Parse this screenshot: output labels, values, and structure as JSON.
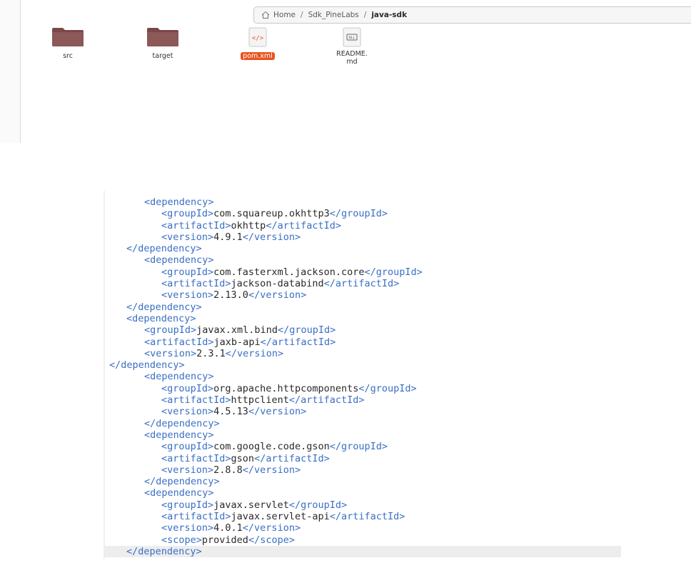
{
  "breadcrumb": {
    "items": [
      "Home",
      "Sdk_PineLabs",
      "java-sdk"
    ],
    "separator": "/"
  },
  "files": [
    {
      "name": "src",
      "type": "folder",
      "icon": "folder-icon"
    },
    {
      "name": "target",
      "type": "folder",
      "icon": "folder-icon"
    },
    {
      "name": "pom.xml",
      "type": "xml",
      "icon": "xml-file-icon",
      "selected": true
    },
    {
      "name": "README.\nmd",
      "type": "markdown",
      "icon": "markdown-file-icon"
    }
  ],
  "colors": {
    "tag": "#3a6fc4",
    "selection": "#e95420",
    "folder": "#8a5a5a"
  },
  "code": [
    {
      "indent": 2,
      "tag": "dependency",
      "kind": "open"
    },
    {
      "indent": 3,
      "tag": "groupId",
      "value": "com.squareup.okhttp3"
    },
    {
      "indent": 3,
      "tag": "artifactId",
      "value": "okhttp"
    },
    {
      "indent": 3,
      "tag": "version",
      "value": "4.9.1"
    },
    {
      "indent": 1,
      "tag": "dependency",
      "kind": "close"
    },
    {
      "indent": 2,
      "tag": "dependency",
      "kind": "open"
    },
    {
      "indent": 3,
      "tag": "groupId",
      "value": "com.fasterxml.jackson.core"
    },
    {
      "indent": 3,
      "tag": "artifactId",
      "value": "jackson-databind"
    },
    {
      "indent": 3,
      "tag": "version",
      "value": "2.13.0"
    },
    {
      "indent": 1,
      "tag": "dependency",
      "kind": "close"
    },
    {
      "indent": 1,
      "tag": "dependency",
      "kind": "open"
    },
    {
      "indent": 2,
      "tag": "groupId",
      "value": "javax.xml.bind"
    },
    {
      "indent": 2,
      "tag": "artifactId",
      "value": "jaxb-api"
    },
    {
      "indent": 2,
      "tag": "version",
      "value": "2.3.1"
    },
    {
      "indent": 0,
      "tag": "dependency",
      "kind": "close"
    },
    {
      "indent": 2,
      "tag": "dependency",
      "kind": "open"
    },
    {
      "indent": 3,
      "tag": "groupId",
      "value": "org.apache.httpcomponents"
    },
    {
      "indent": 3,
      "tag": "artifactId",
      "value": "httpclient"
    },
    {
      "indent": 3,
      "tag": "version",
      "value": "4.5.13"
    },
    {
      "indent": 2,
      "tag": "dependency",
      "kind": "close"
    },
    {
      "indent": 2,
      "tag": "dependency",
      "kind": "open"
    },
    {
      "indent": 3,
      "tag": "groupId",
      "value": "com.google.code.gson"
    },
    {
      "indent": 3,
      "tag": "artifactId",
      "value": "gson"
    },
    {
      "indent": 3,
      "tag": "version",
      "value": "2.8.8"
    },
    {
      "indent": 2,
      "tag": "dependency",
      "kind": "close"
    },
    {
      "indent": 2,
      "tag": "dependency",
      "kind": "open"
    },
    {
      "indent": 3,
      "tag": "groupId",
      "value": "javax.servlet"
    },
    {
      "indent": 3,
      "tag": "artifactId",
      "value": "javax.servlet-api"
    },
    {
      "indent": 3,
      "tag": "version",
      "value": "4.0.1"
    },
    {
      "indent": 3,
      "tag": "scope",
      "value": "provided"
    },
    {
      "indent": 1,
      "tag": "dependency",
      "kind": "close",
      "highlighted": true
    }
  ]
}
